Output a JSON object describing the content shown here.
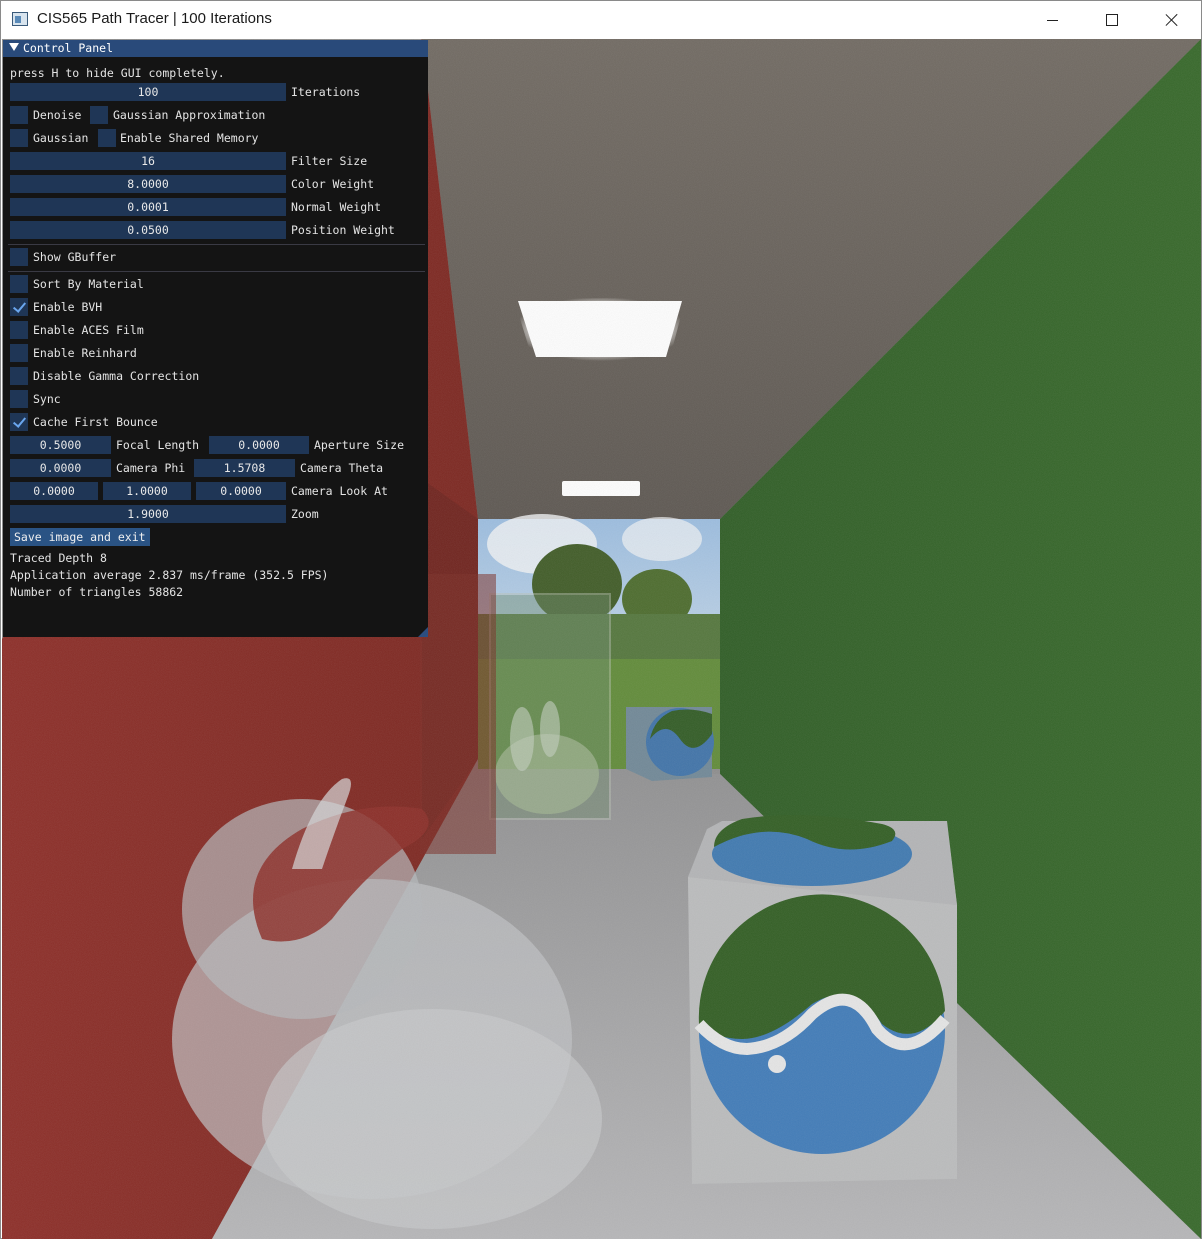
{
  "window": {
    "title": "CIS565 Path Tracer | 100 Iterations"
  },
  "panel": {
    "header": "Control Panel",
    "hint": "press H to hide GUI completely.",
    "iterations": {
      "value": "100",
      "label": "Iterations"
    },
    "denoise_label": "Denoise",
    "gaussian_approx_label": "Gaussian Approximation",
    "gaussian_label": "Gaussian",
    "shared_memory_label": "Enable Shared Memory",
    "filter_size": {
      "value": "16",
      "label": "Filter Size"
    },
    "color_weight": {
      "value": "8.0000",
      "label": "Color Weight"
    },
    "normal_weight": {
      "value": "0.0001",
      "label": "Normal Weight"
    },
    "position_weight": {
      "value": "0.0500",
      "label": "Position Weight"
    },
    "show_gbuffer_label": "Show GBuffer",
    "sort_material_label": "Sort By Material",
    "enable_bvh_label": "Enable BVH",
    "enable_aces_label": "Enable ACES Film",
    "enable_reinhard_label": "Enable Reinhard",
    "disable_gamma_label": "Disable Gamma Correction",
    "sync_label": "Sync",
    "cache_first_bounce_label": "Cache First Bounce",
    "focal_length": {
      "value": "0.5000",
      "label": "Focal Length"
    },
    "aperture_size": {
      "value": "0.0000",
      "label": "Aperture Size"
    },
    "camera_phi": {
      "value": "0.0000",
      "label": "Camera Phi"
    },
    "camera_theta": {
      "value": "1.5708",
      "label": "Camera Theta"
    },
    "camera_look_at": {
      "x": "0.0000",
      "y": "1.0000",
      "z": "0.0000",
      "label": "Camera Look At"
    },
    "zoom": {
      "value": "1.9000",
      "label": "Zoom"
    },
    "save_button": "Save image and exit",
    "traced_depth": "Traced Depth 8",
    "app_average": "Application average 2.837 ms/frame (352.5 FPS)",
    "triangles": "Number of triangles 58862"
  },
  "checkbox_states": {
    "denoise": false,
    "gaussian_approx": false,
    "gaussian": false,
    "shared_memory": false,
    "show_gbuffer": false,
    "sort_material": false,
    "enable_bvh": true,
    "enable_aces": false,
    "enable_reinhard": false,
    "disable_gamma": false,
    "sync": false,
    "cache_first_bounce": true
  },
  "colors": {
    "panel_bg": "#141414",
    "header_bg": "#294a7a",
    "field_bg": "#1f3656",
    "check_color": "#6aa6ee",
    "red_wall": "#8e2a22",
    "green_wall": "#2f5e22",
    "ceiling": "#6e675f",
    "floor": "#a9a9aa"
  }
}
